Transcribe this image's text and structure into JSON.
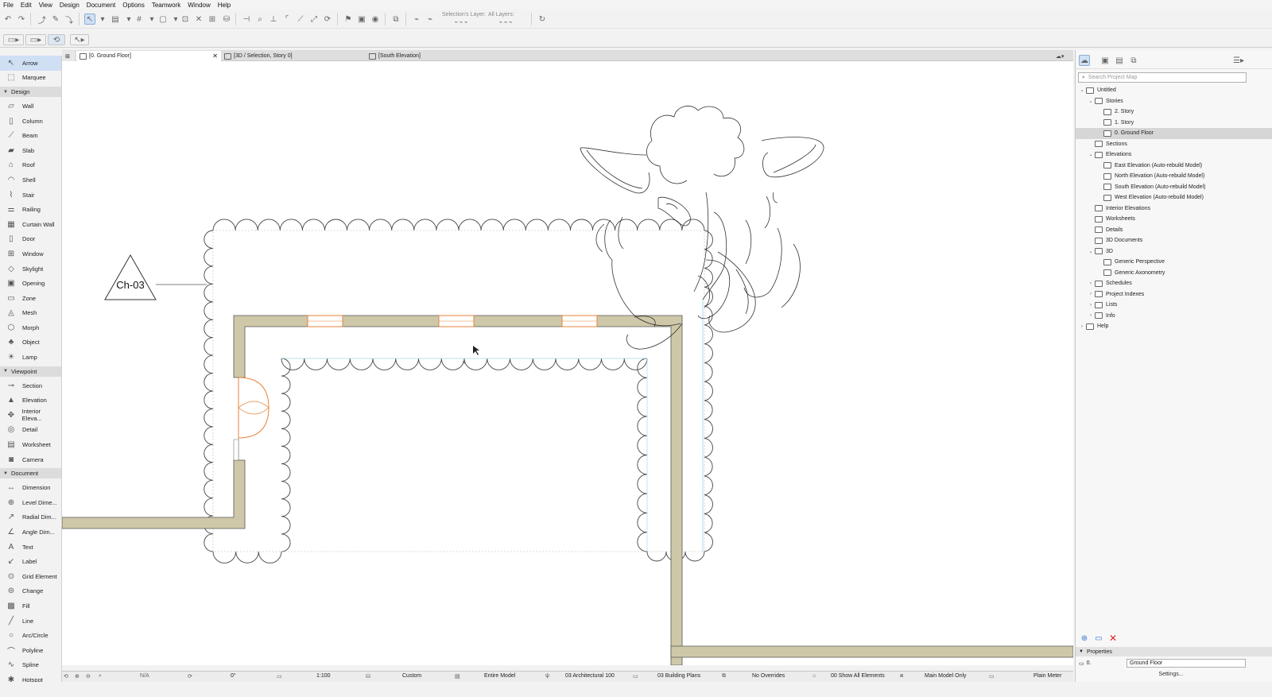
{
  "menu": [
    "File",
    "Edit",
    "View",
    "Design",
    "Document",
    "Options",
    "Teamwork",
    "Window",
    "Help"
  ],
  "toolbar": {
    "selections_layer": "Selection's Layer:",
    "all_layers": "All Layers:"
  },
  "toolbox": {
    "top_tools": [
      {
        "label": "Arrow",
        "icon": "arrow-pointer-icon",
        "selected": true
      },
      {
        "label": "Marquee",
        "icon": "marquee-icon",
        "selected": false
      }
    ],
    "sections": [
      {
        "title": "Design",
        "tools": [
          {
            "label": "Wall",
            "icon": "wall-icon"
          },
          {
            "label": "Column",
            "icon": "column-icon"
          },
          {
            "label": "Beam",
            "icon": "beam-icon"
          },
          {
            "label": "Slab",
            "icon": "slab-icon"
          },
          {
            "label": "Roof",
            "icon": "roof-icon"
          },
          {
            "label": "Shell",
            "icon": "shell-icon"
          },
          {
            "label": "Stair",
            "icon": "stair-icon"
          },
          {
            "label": "Railing",
            "icon": "railing-icon"
          },
          {
            "label": "Curtain Wall",
            "icon": "curtain-wall-icon"
          },
          {
            "label": "Door",
            "icon": "door-icon"
          },
          {
            "label": "Window",
            "icon": "window-icon"
          },
          {
            "label": "Skylight",
            "icon": "skylight-icon"
          },
          {
            "label": "Opening",
            "icon": "opening-icon"
          },
          {
            "label": "Zone",
            "icon": "zone-icon"
          },
          {
            "label": "Mesh",
            "icon": "mesh-icon"
          },
          {
            "label": "Morph",
            "icon": "morph-icon"
          },
          {
            "label": "Object",
            "icon": "object-icon"
          },
          {
            "label": "Lamp",
            "icon": "lamp-icon"
          }
        ]
      },
      {
        "title": "Viewpoint",
        "tools": [
          {
            "label": "Section",
            "icon": "section-icon"
          },
          {
            "label": "Elevation",
            "icon": "elevation-icon"
          },
          {
            "label": "Interior Eleva...",
            "icon": "interior-elevation-icon"
          },
          {
            "label": "Detail",
            "icon": "detail-icon"
          },
          {
            "label": "Worksheet",
            "icon": "worksheet-icon"
          },
          {
            "label": "Camera",
            "icon": "camera-icon"
          }
        ]
      },
      {
        "title": "Document",
        "tools": [
          {
            "label": "Dimension",
            "icon": "dimension-icon"
          },
          {
            "label": "Level Dime...",
            "icon": "level-dimension-icon"
          },
          {
            "label": "Radial Dim...",
            "icon": "radial-dimension-icon"
          },
          {
            "label": "Angle Dim...",
            "icon": "angle-dimension-icon"
          },
          {
            "label": "Text",
            "icon": "text-icon"
          },
          {
            "label": "Label",
            "icon": "label-icon"
          },
          {
            "label": "Grid Element",
            "icon": "grid-element-icon"
          },
          {
            "label": "Change",
            "icon": "change-icon"
          },
          {
            "label": "Fill",
            "icon": "fill-icon"
          },
          {
            "label": "Line",
            "icon": "line-icon"
          },
          {
            "label": "Arc/Circle",
            "icon": "arc-circle-icon"
          },
          {
            "label": "Polyline",
            "icon": "polyline-icon"
          },
          {
            "label": "Spline",
            "icon": "spline-icon"
          },
          {
            "label": "Hotspot",
            "icon": "hotspot-icon"
          }
        ]
      }
    ]
  },
  "tabs": [
    {
      "label": "[0. Ground Floor]",
      "active": true
    },
    {
      "label": "[3D / Selection, Story 0]",
      "active": false
    },
    {
      "label": "[South Elevation]",
      "active": false
    }
  ],
  "drawing": {
    "marker_label": "Ch-03"
  },
  "navigator": {
    "search_placeholder": "Search Project Map",
    "tree": [
      {
        "label": "Untitled",
        "level": 0,
        "arrow": "v"
      },
      {
        "label": "Stories",
        "level": 1,
        "arrow": "v"
      },
      {
        "label": "2. Story",
        "level": 2,
        "arrow": ""
      },
      {
        "label": "1. Story",
        "level": 2,
        "arrow": ""
      },
      {
        "label": "0. Ground Floor",
        "level": 2,
        "arrow": "",
        "selected": true
      },
      {
        "label": "Sections",
        "level": 1,
        "arrow": ""
      },
      {
        "label": "Elevations",
        "level": 1,
        "arrow": "v"
      },
      {
        "label": "East Elevation (Auto-rebuild Model)",
        "level": 2,
        "arrow": ""
      },
      {
        "label": "North Elevation (Auto-rebuild Model)",
        "level": 2,
        "arrow": ""
      },
      {
        "label": "South Elevation (Auto-rebuild Model)",
        "level": 2,
        "arrow": ""
      },
      {
        "label": "West Elevation (Auto-rebuild Model)",
        "level": 2,
        "arrow": ""
      },
      {
        "label": "Interior Elevations",
        "level": 1,
        "arrow": ""
      },
      {
        "label": "Worksheets",
        "level": 1,
        "arrow": ""
      },
      {
        "label": "Details",
        "level": 1,
        "arrow": ""
      },
      {
        "label": "3D Documents",
        "level": 1,
        "arrow": ""
      },
      {
        "label": "3D",
        "level": 1,
        "arrow": "v"
      },
      {
        "label": "Generic Perspective",
        "level": 2,
        "arrow": ""
      },
      {
        "label": "Generic Axonometry",
        "level": 2,
        "arrow": ""
      },
      {
        "label": "Schedules",
        "level": 1,
        "arrow": ">"
      },
      {
        "label": "Project Indexes",
        "level": 1,
        "arrow": ">"
      },
      {
        "label": "Lists",
        "level": 1,
        "arrow": ">"
      },
      {
        "label": "Info",
        "level": 1,
        "arrow": ">"
      },
      {
        "label": "Help",
        "level": 0,
        "arrow": ">"
      }
    ],
    "properties_title": "Properties",
    "prop_id": "0.",
    "prop_value": "Ground Floor",
    "settings_label": "Settings..."
  },
  "status": {
    "na": "N/A",
    "angle": "0°",
    "scale": "1:100",
    "custom": "Custom",
    "model": "Entire Model",
    "layer_combo": "03 Architectural 100",
    "view": "03 Building Plans",
    "overrides": "No Overrides",
    "renovation": "00 Show All Elements",
    "model_only": "Main Model Only",
    "dimension": "Plain Meter"
  },
  "colors": {
    "wall_fill": "#cfc8a8",
    "opening": "#e8823a",
    "selection_blue": "#cfe0f5"
  }
}
